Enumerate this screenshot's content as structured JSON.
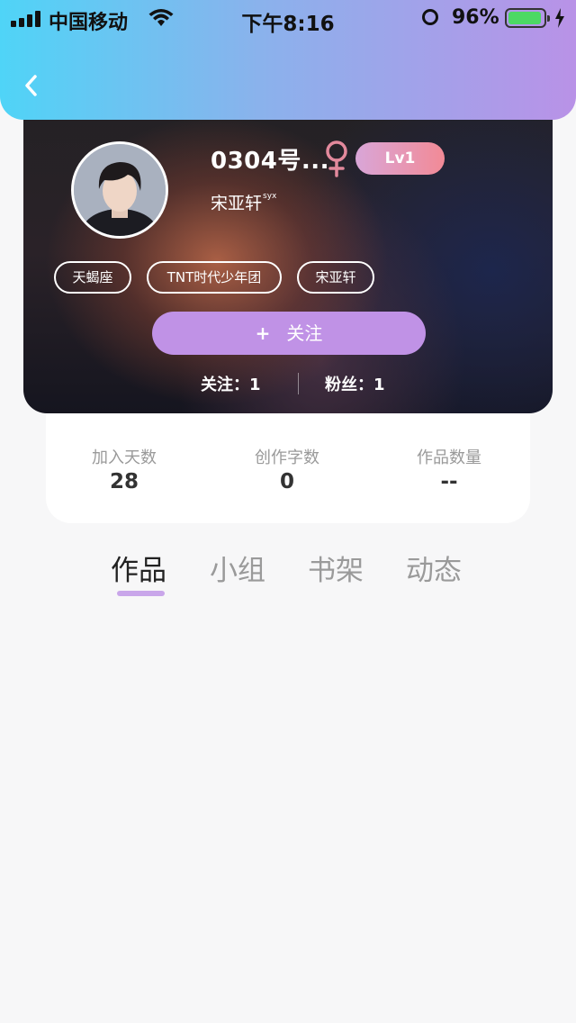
{
  "status_bar": {
    "carrier": "中国移动",
    "time": "下午8:16",
    "battery_percent": "96%",
    "battery_level": 0.96,
    "icons": [
      "signal-icon",
      "wifi-icon",
      "alarm-icon",
      "battery-icon",
      "charging-icon"
    ]
  },
  "header": {
    "back_icon": "chevron-left-icon"
  },
  "profile": {
    "nickname": "0304号...",
    "gender_icon": "female-icon",
    "level": "Lv1",
    "real_name": "宋亚轩",
    "real_name_sup": "syx",
    "tags": [
      "天蝎座",
      "TNT时代少年团",
      "宋亚轩"
    ],
    "follow_plus": "+",
    "follow_label": "关注",
    "following_text": "关注：1",
    "fans_text": "粉丝：1"
  },
  "stats": [
    {
      "label": "加入天数",
      "value": "28"
    },
    {
      "label": "创作字数",
      "value": "0"
    },
    {
      "label": "作品数量",
      "value": "--"
    }
  ],
  "tabs": [
    {
      "label": "作品",
      "active": true
    },
    {
      "label": "小组",
      "active": false
    },
    {
      "label": "书架",
      "active": false
    },
    {
      "label": "动态",
      "active": false
    }
  ],
  "colors": {
    "header_gradient": [
      "#4fd4f7",
      "#8ab2ec",
      "#b992e7"
    ],
    "follow_button": "#c092e6",
    "level_badge": [
      "#d9a6d8",
      "#f28a96"
    ],
    "tab_indicator": "#c9a6ea",
    "female_icon": "#e2899c"
  }
}
